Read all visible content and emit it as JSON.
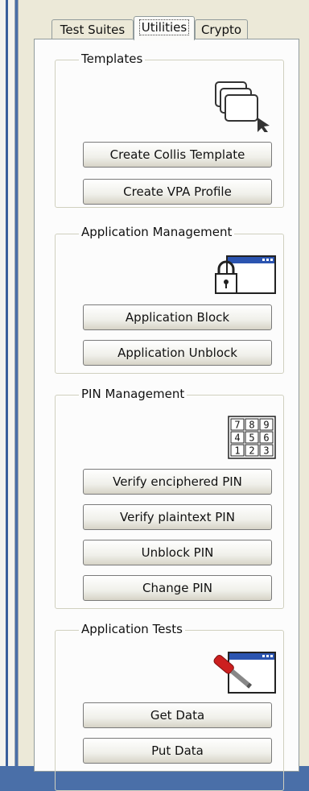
{
  "tabs": [
    {
      "label": "Test Suites"
    },
    {
      "label": "Utilities",
      "active": true
    },
    {
      "label": "Crypto"
    }
  ],
  "groups": {
    "templates": {
      "title": "Templates",
      "icon": "windows-stack-icon",
      "buttons": [
        "Create Collis Template",
        "Create VPA Profile"
      ]
    },
    "app_mgmt": {
      "title": "Application Management",
      "icon": "lock-window-icon",
      "buttons": [
        "Application Block",
        "Application Unblock"
      ]
    },
    "pin_mgmt": {
      "title": "PIN Management",
      "icon": "keypad-icon",
      "keypad_keys": [
        "7",
        "8",
        "9",
        "4",
        "5",
        "6",
        "1",
        "2",
        "3"
      ],
      "buttons": [
        "Verify enciphered PIN",
        "Verify plaintext PIN",
        "Unblock PIN",
        "Change PIN"
      ]
    },
    "app_tests": {
      "title": "Application Tests",
      "icon": "screwdriver-window-icon",
      "buttons": [
        "Get Data",
        "Put Data"
      ]
    }
  },
  "colors": {
    "background_blue": "#4a6fa8",
    "panel": "#fcfcfc",
    "window": "#ece9d8",
    "icon_red": "#cc1f1f"
  }
}
